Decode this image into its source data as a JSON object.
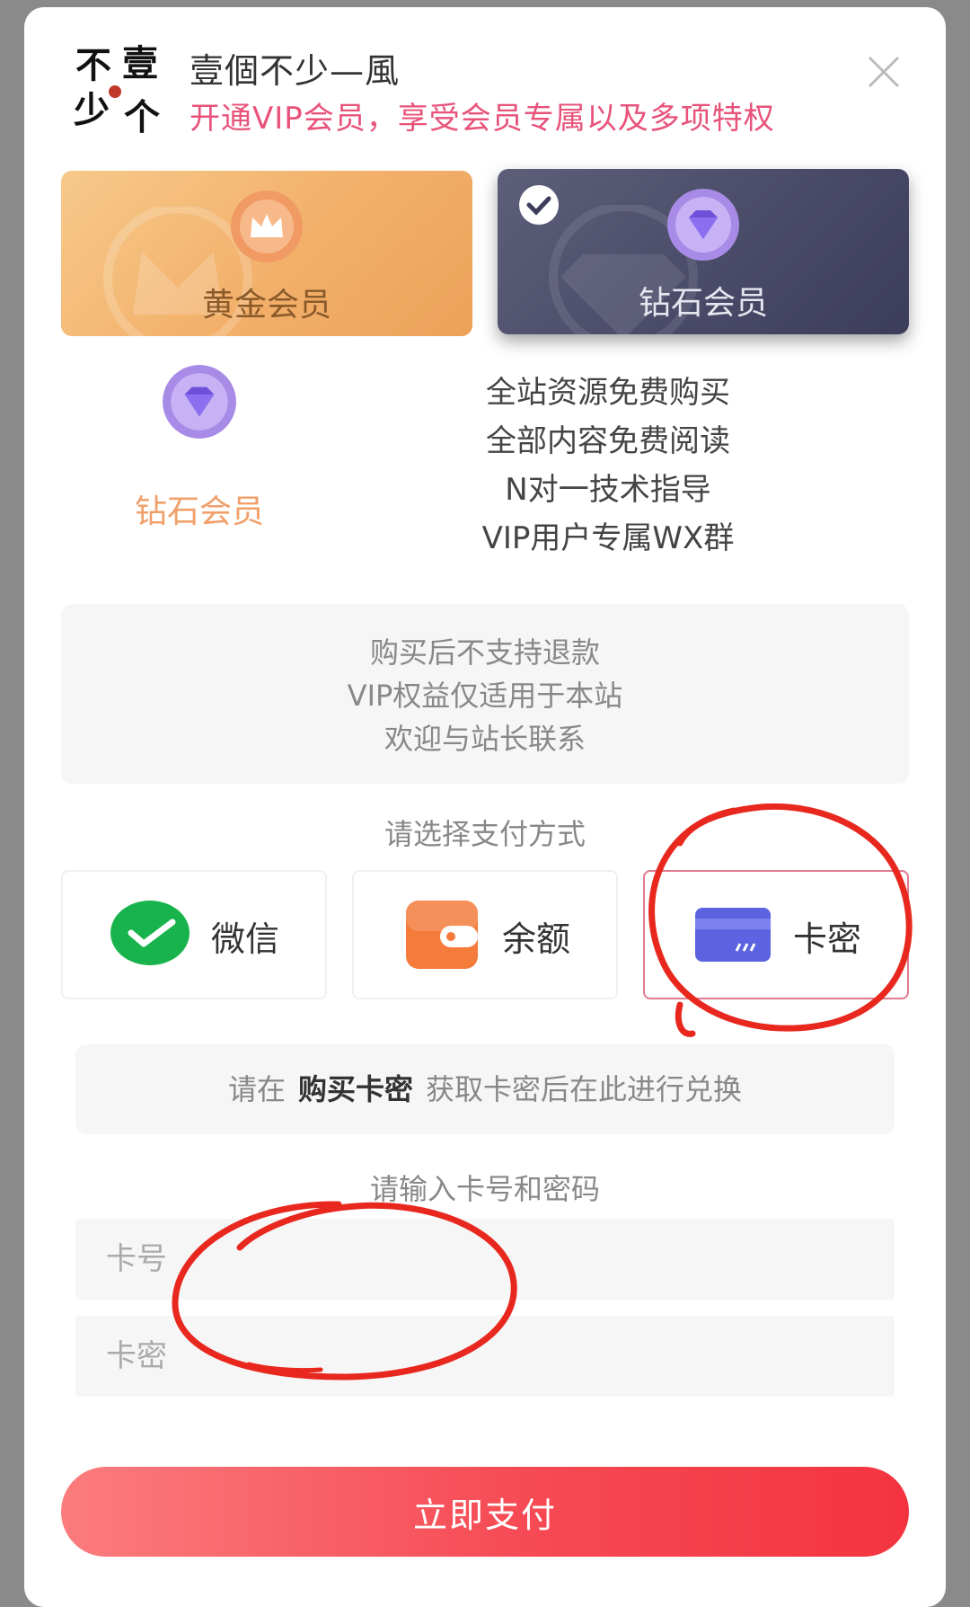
{
  "header": {
    "site_name": "壹個不少—風",
    "tagline": "开通VIP会员，享受会员专属以及多项特权"
  },
  "tiers": [
    {
      "label": "黄金会员",
      "icon": "crown-icon",
      "selected": false
    },
    {
      "label": "钻石会员",
      "icon": "diamond-icon",
      "selected": true
    }
  ],
  "selected_tier": {
    "label": "钻石会员",
    "benefits": [
      "全站资源免费购买",
      "全部内容免费阅读",
      "N对一技术指导",
      "VIP用户专属WX群"
    ]
  },
  "notice": [
    "购买后不支持退款",
    "VIP权益仅适用于本站",
    "欢迎与站长联系"
  ],
  "payment": {
    "title": "请选择支付方式",
    "options": [
      {
        "label": "微信",
        "icon": "wechat-icon",
        "selected": false
      },
      {
        "label": "余额",
        "icon": "wallet-icon",
        "selected": false
      },
      {
        "label": "卡密",
        "icon": "card-icon",
        "selected": true
      }
    ]
  },
  "card_hint": {
    "prefix": "请在",
    "link": "购买卡密",
    "suffix": "获取卡密后在此进行兑换"
  },
  "card_form": {
    "title": "请输入卡号和密码",
    "card_number_placeholder": "卡号",
    "card_password_placeholder": "卡密"
  },
  "submit_label": "立即支付",
  "colors": {
    "accent_pink": "#e8537a",
    "pay_button": "#f64a54",
    "annotation_red": "#e8281e"
  }
}
